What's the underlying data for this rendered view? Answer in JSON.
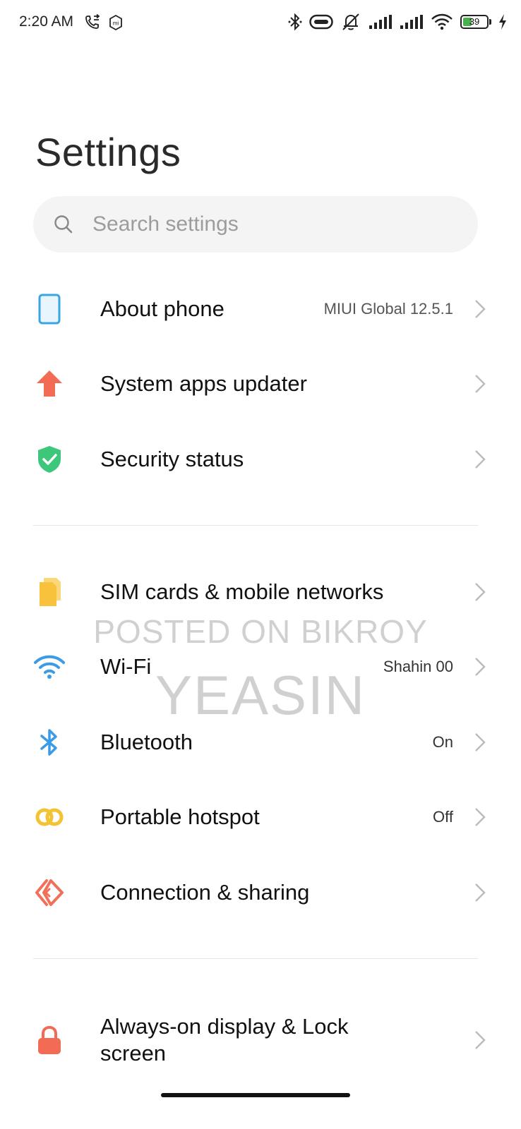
{
  "status_bar": {
    "time": "2:20 AM",
    "battery_level": "39",
    "battery_fraction": 0.39,
    "left_icons": [
      "call-forward-icon",
      "mi-icon"
    ],
    "right_icons": [
      "bluetooth-icon",
      "vpn-key-icon",
      "mute-icon",
      "signal-1-icon",
      "signal-2-icon",
      "wifi-icon",
      "battery-icon",
      "charging-icon"
    ]
  },
  "page": {
    "title": "Settings"
  },
  "search": {
    "placeholder": "Search settings"
  },
  "sections": [
    {
      "items": [
        {
          "label": "About phone",
          "value": "MIUI Global 12.5.1",
          "icon": "phone-outline-icon"
        },
        {
          "label": "System apps updater",
          "value": "",
          "icon": "arrow-up-icon"
        },
        {
          "label": "Security status",
          "value": "",
          "icon": "shield-check-icon"
        }
      ]
    },
    {
      "items": [
        {
          "label": "SIM cards & mobile networks",
          "value": "",
          "icon": "sim-card-icon"
        },
        {
          "label": "Wi-Fi",
          "value": "Shahin 00",
          "icon": "wifi-icon"
        },
        {
          "label": "Bluetooth",
          "value": "On",
          "icon": "bluetooth-icon"
        },
        {
          "label": "Portable hotspot",
          "value": "Off",
          "icon": "hotspot-icon"
        },
        {
          "label": "Connection & sharing",
          "value": "",
          "icon": "connection-sharing-icon"
        }
      ]
    },
    {
      "items": [
        {
          "label": "Always-on display & Lock screen",
          "value": "",
          "icon": "lock-icon"
        }
      ]
    }
  ],
  "watermark": {
    "line1": "POSTED ON BIKROY",
    "line2": "YEASIN"
  },
  "colors": {
    "about_phone_icon": "#3aa6e0",
    "updater_icon": "#f26b55",
    "security_icon": "#3cc77a",
    "sim_icon": "#f9c23c",
    "wifi_icon": "#3a9be8",
    "bluetooth_icon": "#3a9be8",
    "hotspot_icon": "#f4c333",
    "connection_icon": "#f0705a",
    "lock_icon": "#f26b55"
  }
}
